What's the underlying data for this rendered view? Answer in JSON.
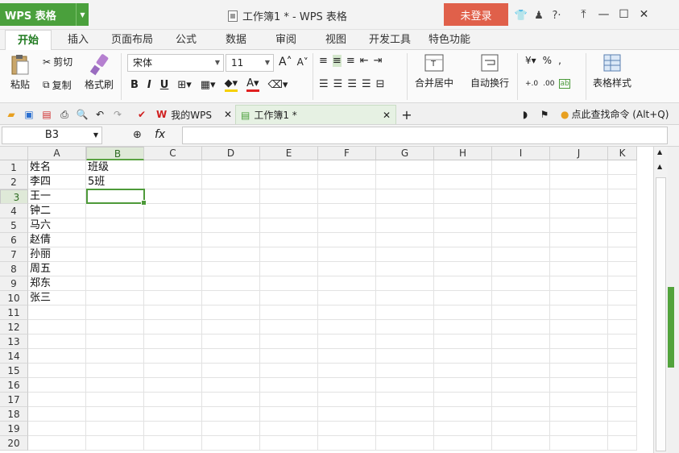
{
  "app": {
    "name": "WPS 表格",
    "doc_title": "工作簿1 * - WPS 表格",
    "login_label": "未登录"
  },
  "ribbon_tabs": [
    "开始",
    "插入",
    "页面布局",
    "公式",
    "数据",
    "审阅",
    "视图",
    "开发工具",
    "特色功能"
  ],
  "ribbon": {
    "cut": "剪切",
    "paste": "粘贴",
    "copy": "复制",
    "format_painter": "格式刷",
    "font_name": "宋体",
    "font_size": "11",
    "merge_center": "合并居中",
    "wrap_text": "自动换行",
    "table_style": "表格样式"
  },
  "quickbar": {
    "my_wps": "我的WPS",
    "doc_tab": "工作簿1 *",
    "search_cmd": "点此查找命令 (Alt+Q)"
  },
  "formula": {
    "name_box": "B3",
    "fx": "fx",
    "value": ""
  },
  "columns": [
    "A",
    "B",
    "C",
    "D",
    "E",
    "F",
    "G",
    "H",
    "I",
    "J",
    "K"
  ],
  "rows": [
    "1",
    "2",
    "3",
    "4",
    "5",
    "6",
    "7",
    "8",
    "9",
    "10",
    "11",
    "12",
    "13",
    "14",
    "15",
    "16",
    "17",
    "18",
    "19",
    "20"
  ],
  "cells": {
    "A": [
      "姓名",
      "李四",
      "王一",
      "钟二",
      "马六",
      "赵倩",
      "孙丽",
      "周五",
      "郑东",
      "张三"
    ],
    "B": [
      "班级",
      "5班"
    ]
  },
  "colors": {
    "accent_green": "#4aa03c",
    "login_red": "#e0604a"
  }
}
